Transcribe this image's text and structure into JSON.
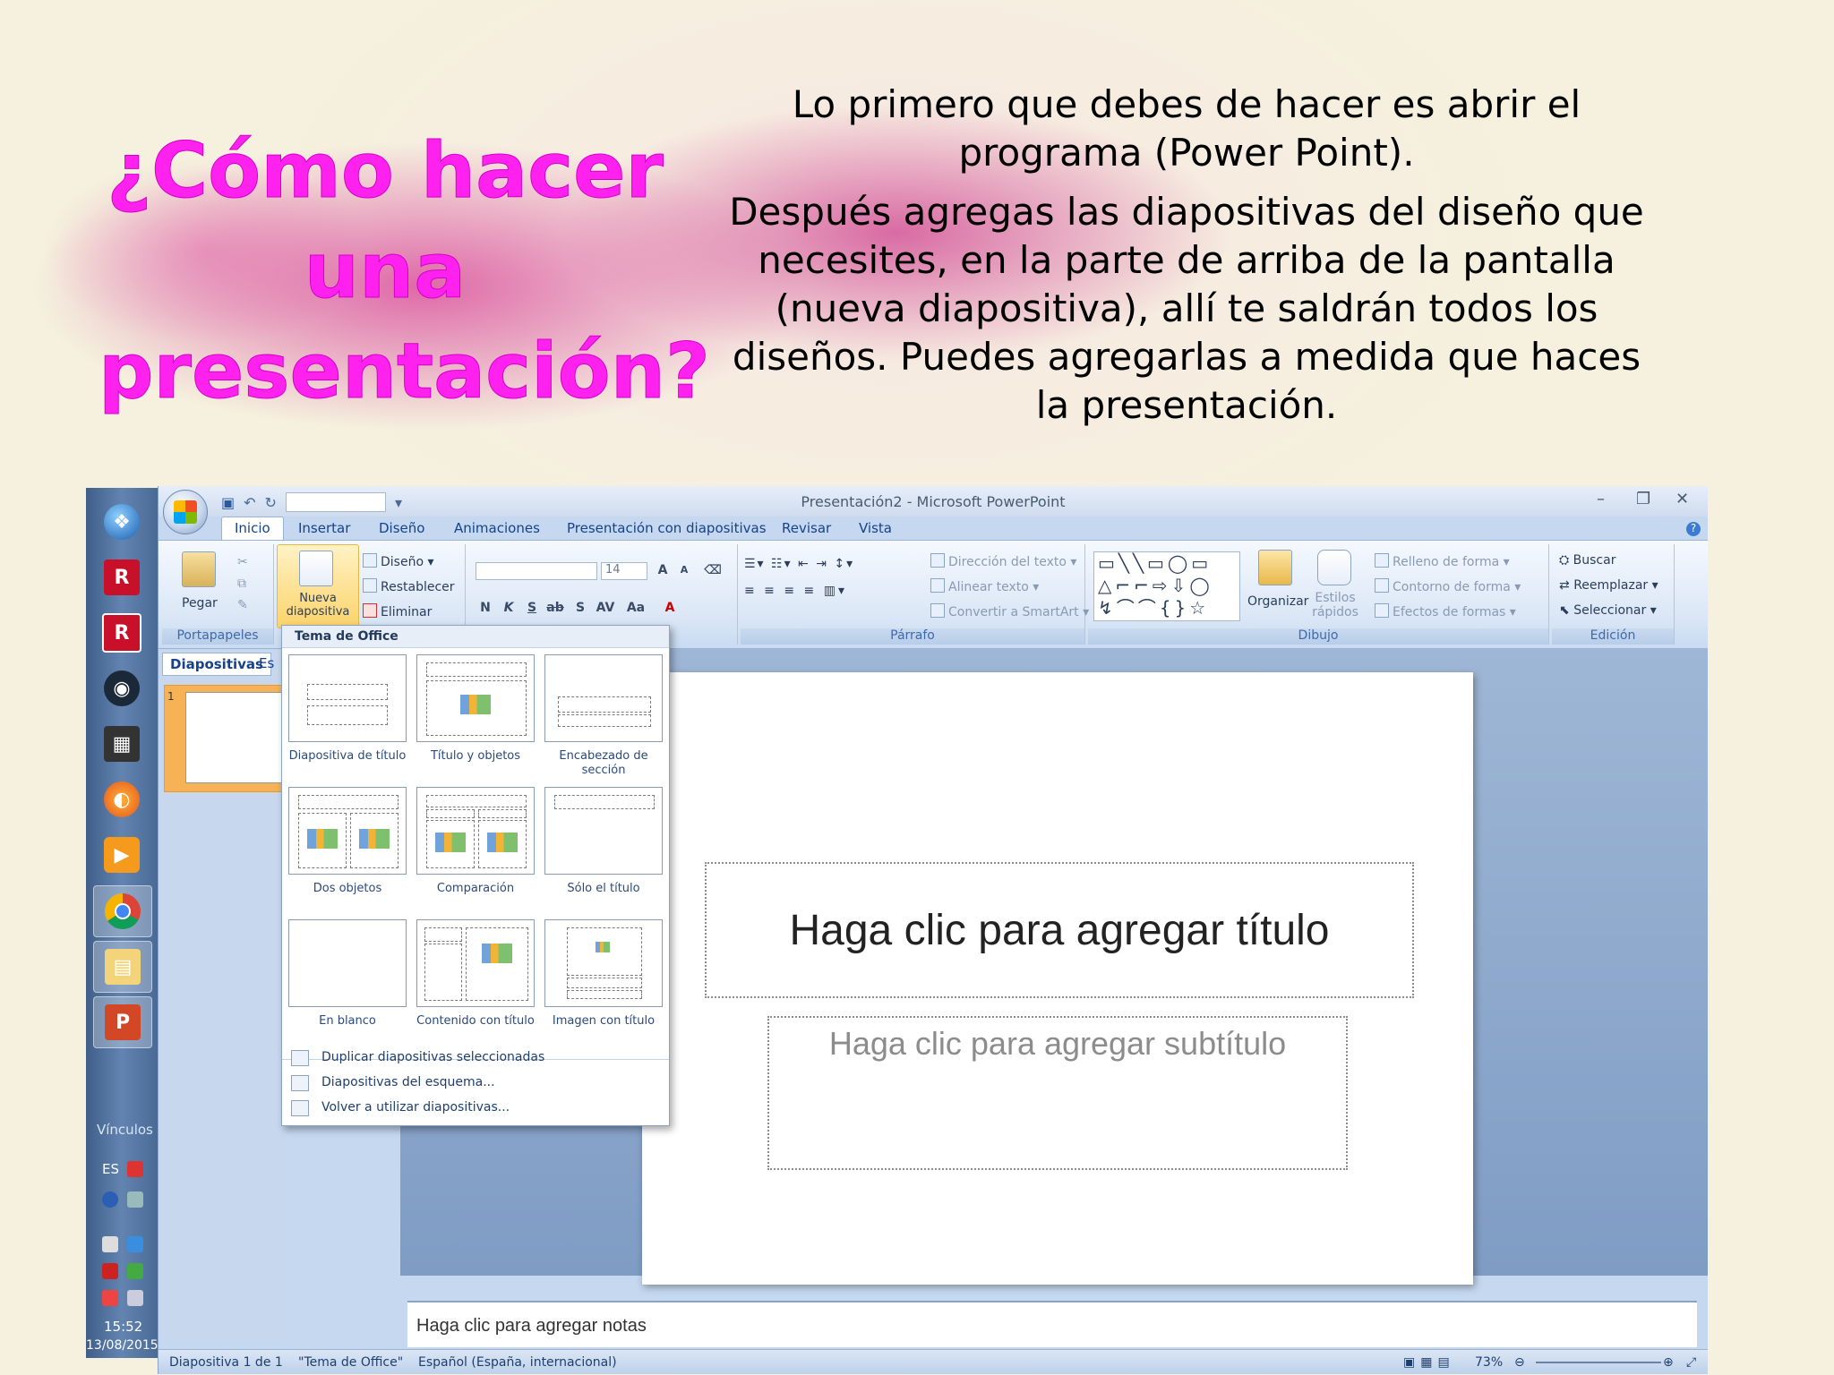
{
  "slide": {
    "title": "¿Cómo hacer una presentación?",
    "paragraph1": "Lo primero que debes de hacer es abrir el programa (Power Point).",
    "paragraph2": "Después agregas las diapositivas del diseño que necesites, en la parte de arriba de la pantalla (nueva diapositiva), allí te saldrán todos los diseños. Puedes agregarlas a medida que haces la presentación."
  },
  "window": {
    "title": "Presentación2 - Microsoft PowerPoint",
    "tabs": [
      "Inicio",
      "Insertar",
      "Diseño",
      "Animaciones",
      "Presentación con diapositivas",
      "Revisar",
      "Vista"
    ],
    "selected_tab": "Inicio"
  },
  "ribbon": {
    "portapapeles": {
      "paste": "Pegar",
      "label": "Portapapeles"
    },
    "diapositivas": {
      "new_slide": "Nueva diapositiva",
      "layout": "Diseño",
      "reset": "Restablecer",
      "delete": "Eliminar"
    },
    "fuente": {
      "font_size": "14"
    },
    "parrafo": {
      "text_direction": "Dirección del texto",
      "align_text": "Alinear texto",
      "smartart": "Convertir a SmartArt",
      "label": "Párrafo"
    },
    "dibujo": {
      "arrange": "Organizar",
      "quick_styles": "Estilos rápidos",
      "fill": "Relleno de forma",
      "outline": "Contorno de forma",
      "effects": "Efectos de formas",
      "label": "Dibujo"
    },
    "edicion": {
      "find": "Buscar",
      "replace": "Reemplazar",
      "select": "Seleccionar",
      "label": "Edición"
    }
  },
  "left_pane": {
    "tab_slides": "Diapositivas",
    "tab_outline": "Es",
    "slide_number": "1"
  },
  "dropdown": {
    "header": "Tema de Office",
    "layouts": [
      "Diapositiva de título",
      "Título y objetos",
      "Encabezado de sección",
      "Dos objetos",
      "Comparación",
      "Sólo el título",
      "En blanco",
      "Contenido con título",
      "Imagen con título"
    ],
    "commands": [
      "Duplicar diapositivas seleccionadas",
      "Diapositivas del esquema...",
      "Volver a utilizar diapositivas..."
    ]
  },
  "placeholders": {
    "title": "Haga clic para agregar título",
    "subtitle": "Haga clic para agregar subtítulo",
    "notes": "Haga clic para agregar notas"
  },
  "status": {
    "slide_info": "Diapositiva 1 de 1",
    "theme": "\"Tema de Office\"",
    "language": "Español (España, internacional)",
    "zoom": "73%"
  },
  "taskbar": {
    "vinculos": "Vínculos",
    "lang": "ES",
    "time": "15:52",
    "date": "13/08/2015"
  }
}
